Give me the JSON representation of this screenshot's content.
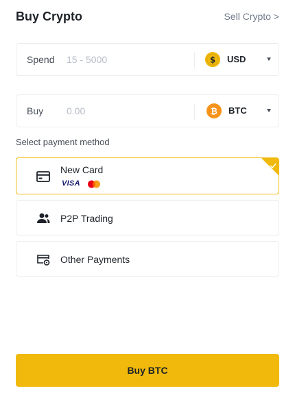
{
  "header": {
    "title": "Buy Crypto",
    "sell_link": "Sell Crypto >"
  },
  "spend": {
    "label": "Spend",
    "placeholder": "15 - 5000",
    "currency": "USD",
    "currency_icon": "dollar-coin-icon"
  },
  "buy": {
    "label": "Buy",
    "placeholder": "0.00",
    "currency": "BTC",
    "currency_icon": "bitcoin-icon"
  },
  "payment": {
    "section_label": "Select payment method",
    "methods": [
      {
        "label": "New Card",
        "icon": "card-icon",
        "selected": true,
        "brands": [
          "VISA",
          "Mastercard"
        ]
      },
      {
        "label": "P2P Trading",
        "icon": "users-icon",
        "selected": false
      },
      {
        "label": "Other Payments",
        "icon": "card-settings-icon",
        "selected": false
      }
    ]
  },
  "actions": {
    "buy_button": "Buy BTC"
  },
  "colors": {
    "accent": "#F0B90B",
    "text": "#1E2329",
    "muted": "#707A8A",
    "border": "#EAECEF",
    "bitcoin": "#F7931A",
    "visa": "#1A1F71",
    "mastercard_red": "#EB001B",
    "mastercard_orange": "#F79E1B"
  }
}
